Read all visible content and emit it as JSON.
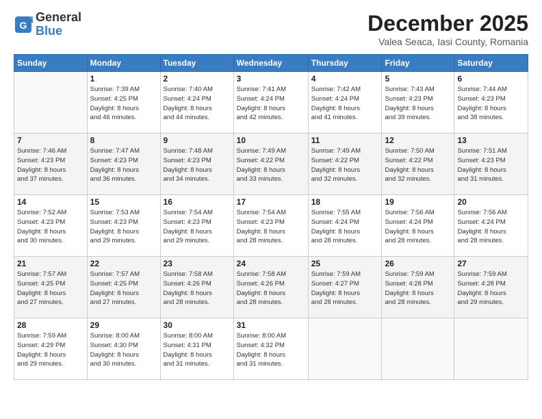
{
  "header": {
    "logo": {
      "general": "General",
      "blue": "Blue"
    },
    "title": "December 2025",
    "location": "Valea Seaca, Iasi County, Romania"
  },
  "days_of_week": [
    "Sunday",
    "Monday",
    "Tuesday",
    "Wednesday",
    "Thursday",
    "Friday",
    "Saturday"
  ],
  "weeks": [
    [
      {
        "day": "",
        "text": ""
      },
      {
        "day": "1",
        "text": "Sunrise: 7:39 AM\nSunset: 4:25 PM\nDaylight: 8 hours\nand 46 minutes."
      },
      {
        "day": "2",
        "text": "Sunrise: 7:40 AM\nSunset: 4:24 PM\nDaylight: 8 hours\nand 44 minutes."
      },
      {
        "day": "3",
        "text": "Sunrise: 7:41 AM\nSunset: 4:24 PM\nDaylight: 8 hours\nand 42 minutes."
      },
      {
        "day": "4",
        "text": "Sunrise: 7:42 AM\nSunset: 4:24 PM\nDaylight: 8 hours\nand 41 minutes."
      },
      {
        "day": "5",
        "text": "Sunrise: 7:43 AM\nSunset: 4:23 PM\nDaylight: 8 hours\nand 39 minutes."
      },
      {
        "day": "6",
        "text": "Sunrise: 7:44 AM\nSunset: 4:23 PM\nDaylight: 8 hours\nand 38 minutes."
      }
    ],
    [
      {
        "day": "7",
        "text": "Sunrise: 7:46 AM\nSunset: 4:23 PM\nDaylight: 8 hours\nand 37 minutes."
      },
      {
        "day": "8",
        "text": "Sunrise: 7:47 AM\nSunset: 4:23 PM\nDaylight: 8 hours\nand 36 minutes."
      },
      {
        "day": "9",
        "text": "Sunrise: 7:48 AM\nSunset: 4:23 PM\nDaylight: 8 hours\nand 34 minutes."
      },
      {
        "day": "10",
        "text": "Sunrise: 7:49 AM\nSunset: 4:22 PM\nDaylight: 8 hours\nand 33 minutes."
      },
      {
        "day": "11",
        "text": "Sunrise: 7:49 AM\nSunset: 4:22 PM\nDaylight: 8 hours\nand 32 minutes."
      },
      {
        "day": "12",
        "text": "Sunrise: 7:50 AM\nSunset: 4:22 PM\nDaylight: 8 hours\nand 32 minutes."
      },
      {
        "day": "13",
        "text": "Sunrise: 7:51 AM\nSunset: 4:23 PM\nDaylight: 8 hours\nand 31 minutes."
      }
    ],
    [
      {
        "day": "14",
        "text": "Sunrise: 7:52 AM\nSunset: 4:23 PM\nDaylight: 8 hours\nand 30 minutes."
      },
      {
        "day": "15",
        "text": "Sunrise: 7:53 AM\nSunset: 4:23 PM\nDaylight: 8 hours\nand 29 minutes."
      },
      {
        "day": "16",
        "text": "Sunrise: 7:54 AM\nSunset: 4:23 PM\nDaylight: 8 hours\nand 29 minutes."
      },
      {
        "day": "17",
        "text": "Sunrise: 7:54 AM\nSunset: 4:23 PM\nDaylight: 8 hours\nand 28 minutes."
      },
      {
        "day": "18",
        "text": "Sunrise: 7:55 AM\nSunset: 4:24 PM\nDaylight: 8 hours\nand 28 minutes."
      },
      {
        "day": "19",
        "text": "Sunrise: 7:56 AM\nSunset: 4:24 PM\nDaylight: 8 hours\nand 28 minutes."
      },
      {
        "day": "20",
        "text": "Sunrise: 7:56 AM\nSunset: 4:24 PM\nDaylight: 8 hours\nand 28 minutes."
      }
    ],
    [
      {
        "day": "21",
        "text": "Sunrise: 7:57 AM\nSunset: 4:25 PM\nDaylight: 8 hours\nand 27 minutes."
      },
      {
        "day": "22",
        "text": "Sunrise: 7:57 AM\nSunset: 4:25 PM\nDaylight: 8 hours\nand 27 minutes."
      },
      {
        "day": "23",
        "text": "Sunrise: 7:58 AM\nSunset: 4:26 PM\nDaylight: 8 hours\nand 28 minutes."
      },
      {
        "day": "24",
        "text": "Sunrise: 7:58 AM\nSunset: 4:26 PM\nDaylight: 8 hours\nand 28 minutes."
      },
      {
        "day": "25",
        "text": "Sunrise: 7:59 AM\nSunset: 4:27 PM\nDaylight: 8 hours\nand 28 minutes."
      },
      {
        "day": "26",
        "text": "Sunrise: 7:59 AM\nSunset: 4:28 PM\nDaylight: 8 hours\nand 28 minutes."
      },
      {
        "day": "27",
        "text": "Sunrise: 7:59 AM\nSunset: 4:28 PM\nDaylight: 8 hours\nand 29 minutes."
      }
    ],
    [
      {
        "day": "28",
        "text": "Sunrise: 7:59 AM\nSunset: 4:29 PM\nDaylight: 8 hours\nand 29 minutes."
      },
      {
        "day": "29",
        "text": "Sunrise: 8:00 AM\nSunset: 4:30 PM\nDaylight: 8 hours\nand 30 minutes."
      },
      {
        "day": "30",
        "text": "Sunrise: 8:00 AM\nSunset: 4:31 PM\nDaylight: 8 hours\nand 31 minutes."
      },
      {
        "day": "31",
        "text": "Sunrise: 8:00 AM\nSunset: 4:32 PM\nDaylight: 8 hours\nand 31 minutes."
      },
      {
        "day": "",
        "text": ""
      },
      {
        "day": "",
        "text": ""
      },
      {
        "day": "",
        "text": ""
      }
    ]
  ]
}
